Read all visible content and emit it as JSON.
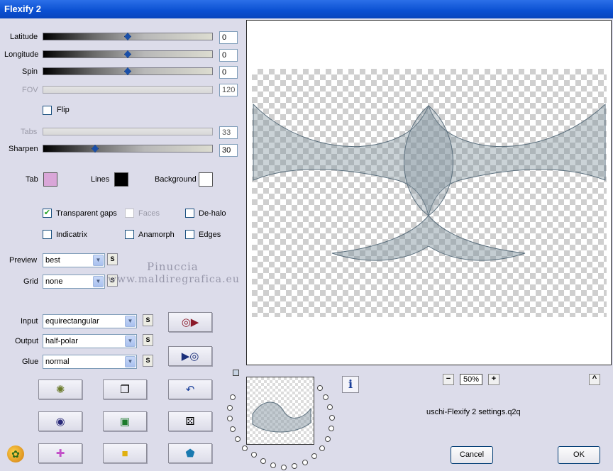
{
  "window": {
    "title": "Flexify 2"
  },
  "sliders": {
    "latitude": {
      "label": "Latitude",
      "value": "0"
    },
    "longitude": {
      "label": "Longitude",
      "value": "0"
    },
    "spin": {
      "label": "Spin",
      "value": "0"
    },
    "fov": {
      "label": "FOV",
      "value": "120"
    },
    "tabs": {
      "label": "Tabs",
      "value": "33"
    },
    "sharpen": {
      "label": "Sharpen",
      "value": "30"
    }
  },
  "flip": {
    "label": "Flip",
    "checked": false
  },
  "colors": {
    "tab": {
      "label": "Tab",
      "color": "#d9a6d8"
    },
    "lines": {
      "label": "Lines",
      "color": "#000000"
    },
    "background": {
      "label": "Background",
      "color": "#ffffff"
    }
  },
  "options": {
    "transparent_gaps": {
      "label": "Transparent gaps",
      "checked": true
    },
    "faces": {
      "label": "Faces",
      "checked": false
    },
    "de_halo": {
      "label": "De-halo",
      "checked": false
    },
    "indicatrix": {
      "label": "Indicatrix",
      "checked": false
    },
    "anamorph": {
      "label": "Anamorph",
      "checked": false
    },
    "edges": {
      "label": "Edges",
      "checked": false
    }
  },
  "preview": {
    "label": "Preview",
    "value": "best"
  },
  "grid": {
    "label": "Grid",
    "value": "none"
  },
  "input": {
    "label": "Input",
    "value": "equirectangular"
  },
  "output": {
    "label": "Output",
    "value": "half-polar"
  },
  "glue": {
    "label": "Glue",
    "value": "normal"
  },
  "s_button": "S",
  "zoom": {
    "minus": "−",
    "value": "50%",
    "plus": "+",
    "collapse": "^"
  },
  "settings_file": "uschi-Flexify 2 settings.q2q",
  "info_glyph": "i",
  "buttons": {
    "cancel": "Cancel",
    "ok": "OK"
  },
  "watermark": {
    "line1": "Pinuccia",
    "line2": "www.maldiregrafica.eu"
  }
}
